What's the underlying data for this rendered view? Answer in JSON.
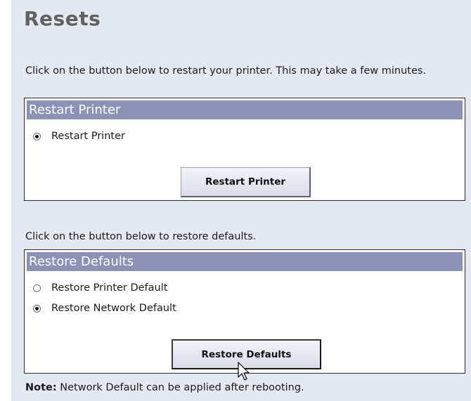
{
  "page": {
    "title": "Resets"
  },
  "restart": {
    "intro": "Click on the button below to restart your printer. This may take a few minutes.",
    "header": "Restart Printer",
    "options": [
      {
        "label": "Restart Printer",
        "checked": true
      }
    ],
    "button_label": "Restart Printer"
  },
  "restore": {
    "intro": "Click on the button below to restore defaults.",
    "header": "Restore Defaults",
    "options": [
      {
        "label": "Restore Printer Default",
        "checked": false
      },
      {
        "label": "Restore Network Default",
        "checked": true
      }
    ],
    "button_label": "Restore Defaults"
  },
  "note": {
    "label": "Note:",
    "text": " Network Default can be applied after rebooting."
  },
  "colors": {
    "panel_bg": "#e3e8f1",
    "header_bg": "#8b92b6",
    "title": "#616161"
  },
  "icons": {
    "cursor": "mouse-pointer-icon"
  }
}
